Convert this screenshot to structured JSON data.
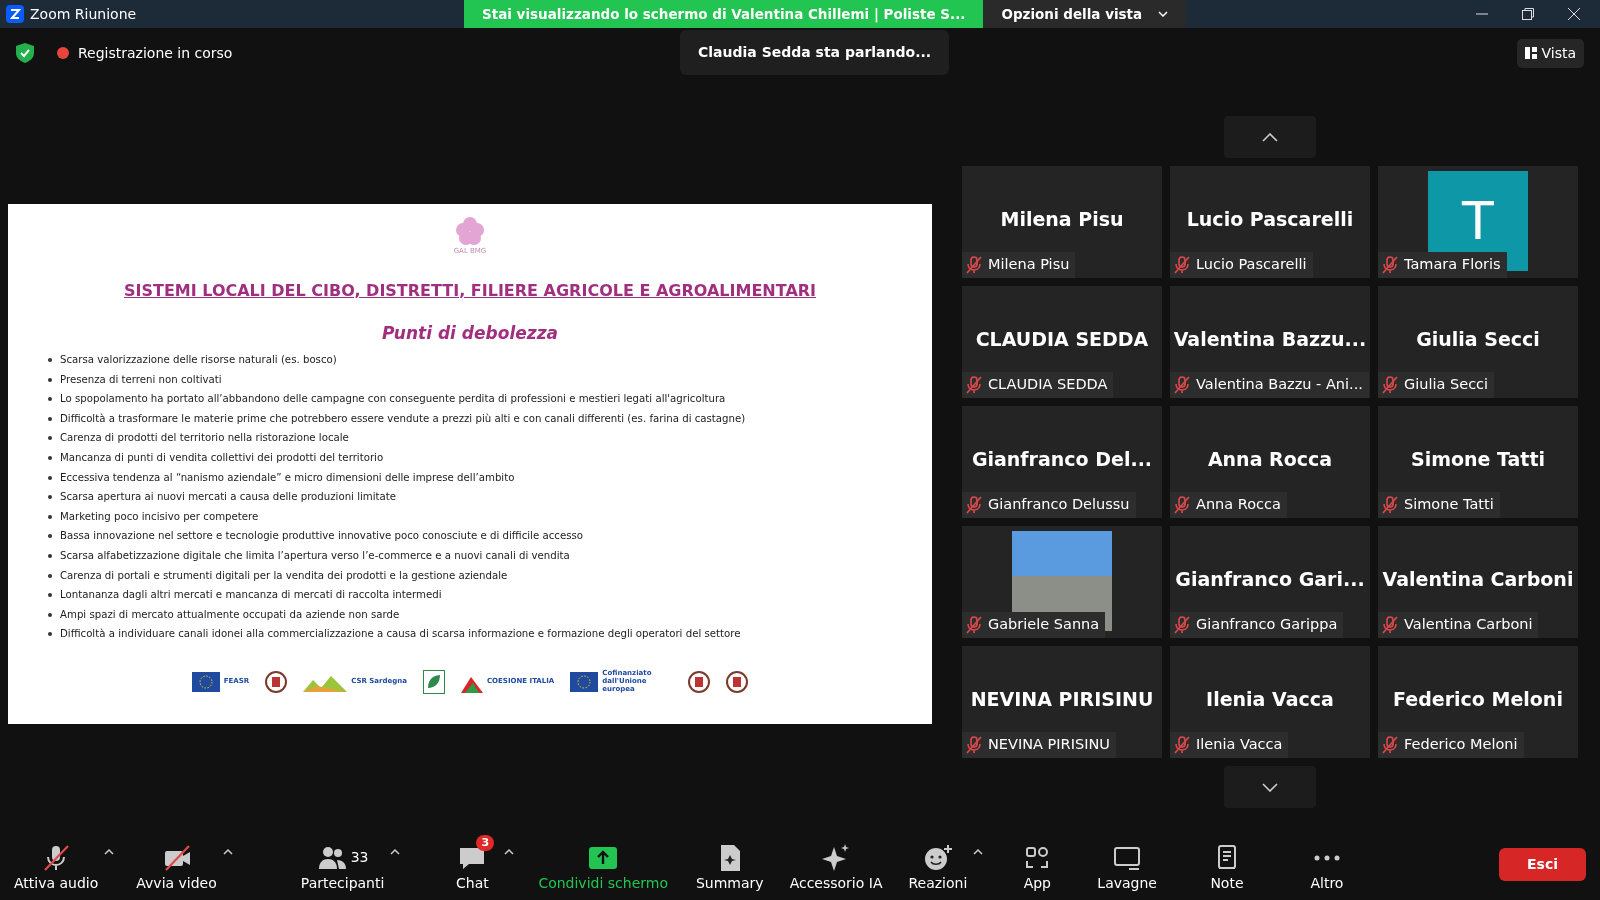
{
  "window": {
    "title": "Zoom Riunione"
  },
  "share_banner": {
    "text": "Stai visualizzando lo schermo di Valentina Chillemi | Poliste S...",
    "view_options": "Opzioni della vista"
  },
  "meeting_bar": {
    "recording": "Registrazione in corso",
    "speaking": "Claudia Sedda sta parlando...",
    "view_button": "Vista"
  },
  "slide": {
    "logo_caption": "GAL BMG",
    "title": "SISTEMI LOCALI DEL CIBO, DISTRETTI, FILIERE AGRICOLE E AGROALIMENTARI",
    "subtitle": "Punti di debolezza",
    "bullets": [
      "Scarsa valorizzazione delle risorse naturali (es. bosco)",
      "Presenza di terreni non coltivati",
      "Lo spopolamento ha portato all’abbandono delle campagne con conseguente perdita di professioni e mestieri legati all'agricoltura",
      "Difficoltà a trasformare le materie prime che potrebbero essere vendute a prezzi più alti e con canali differenti (es. farina di castagne)",
      "Carenza di prodotti del territorio nella ristorazione locale",
      "Mancanza di punti di vendita collettivi dei prodotti del territorio",
      "Eccessiva tendenza al “nanismo aziendale” e micro dimensioni delle imprese dell’ambito",
      "Scarsa apertura ai nuovi mercati a causa delle produzioni limitate",
      "Marketing poco incisivo per competere",
      "Bassa innovazione nel settore e tecnologie produttive innovative poco conosciute e di difficile accesso",
      "Scarsa alfabetizzazione digitale che limita l’apertura verso l’e-commerce e a nuovi canali di vendita",
      "Carenza di portali e strumenti digitali per la vendita dei prodotti e la gestione aziendale",
      "Lontananza dagli altri mercati e mancanza di mercati di raccolta intermedi",
      "Ampi spazi di mercato attualmente occupati da aziende non sarde",
      "Difficoltà a individuare canali idonei alla commercializzazione a causa di scarsa informazione e formazione degli operatori del settore"
    ],
    "logos": [
      {
        "kind": "eu",
        "text": "FEASR"
      },
      {
        "kind": "emblem"
      },
      {
        "kind": "hills",
        "text": "CSR Sardegna"
      },
      {
        "kind": "leaf"
      },
      {
        "kind": "coesione",
        "text": "COESIONE ITALIA"
      },
      {
        "kind": "eu",
        "text": "Cofinanziato dall'Unione europea"
      },
      {
        "kind": "emblem"
      },
      {
        "kind": "emblem"
      }
    ]
  },
  "participants": [
    {
      "kind": "name",
      "display": "Milena Pisu",
      "label": "Milena Pisu",
      "muted": true
    },
    {
      "kind": "name",
      "display": "Lucio Pascarelli",
      "label": "Lucio Pascarelli",
      "muted": true
    },
    {
      "kind": "avatar",
      "display": "T",
      "label": "Tamara Floris",
      "muted": true,
      "color": "#0e97a6"
    },
    {
      "kind": "name",
      "display": "CLAUDIA SEDDA",
      "label": "CLAUDIA SEDDA",
      "muted": true
    },
    {
      "kind": "name",
      "display": "Valentina  Bazzu...",
      "label": "Valentina Bazzu - Ani...",
      "muted": true
    },
    {
      "kind": "name",
      "display": "Giulia Secci",
      "label": "Giulia Secci",
      "muted": true
    },
    {
      "kind": "name",
      "display": "Gianfranco  Del...",
      "label": "Gianfranco Delussu",
      "muted": true
    },
    {
      "kind": "name",
      "display": "Anna Rocca",
      "label": "Anna Rocca",
      "muted": true
    },
    {
      "kind": "name",
      "display": "Simone Tatti",
      "label": "Simone Tatti",
      "muted": true
    },
    {
      "kind": "photo",
      "label": "Gabriele Sanna",
      "muted": true
    },
    {
      "kind": "name",
      "display": "Gianfranco  Gari...",
      "label": "Gianfranco Garippa",
      "muted": true
    },
    {
      "kind": "name",
      "display": "Valentina Carboni",
      "label": "Valentina Carboni",
      "muted": true
    },
    {
      "kind": "name",
      "display": "NEVINA PIRISINU",
      "label": "NEVINA PIRISINU",
      "muted": true
    },
    {
      "kind": "name",
      "display": "Ilenia Vacca",
      "label": "Ilenia Vacca",
      "muted": true
    },
    {
      "kind": "name",
      "display": "Federico Meloni",
      "label": "Federico Meloni",
      "muted": true
    }
  ],
  "toolbar": [
    {
      "kind": "mic",
      "label": "Attiva audio",
      "off": true,
      "caret": true
    },
    {
      "kind": "camera",
      "label": "Avvia video",
      "off": true,
      "caret": true
    },
    {
      "kind": "people",
      "label": "Partecipanti",
      "count": "33",
      "caret": true
    },
    {
      "kind": "chat",
      "label": "Chat",
      "badge": "3",
      "caret": true
    },
    {
      "kind": "share",
      "label": "Condividi schermo",
      "active": true
    },
    {
      "kind": "doc",
      "label": "Summary"
    },
    {
      "kind": "sparkle",
      "label": "Accessorio IA"
    },
    {
      "kind": "smile",
      "label": "Reazioni",
      "caret": true
    },
    {
      "kind": "apps",
      "label": "App"
    },
    {
      "kind": "board",
      "label": "Lavagne"
    },
    {
      "kind": "note",
      "label": "Note"
    },
    {
      "kind": "dots",
      "label": "Altro"
    }
  ],
  "leave_button": "Esci"
}
